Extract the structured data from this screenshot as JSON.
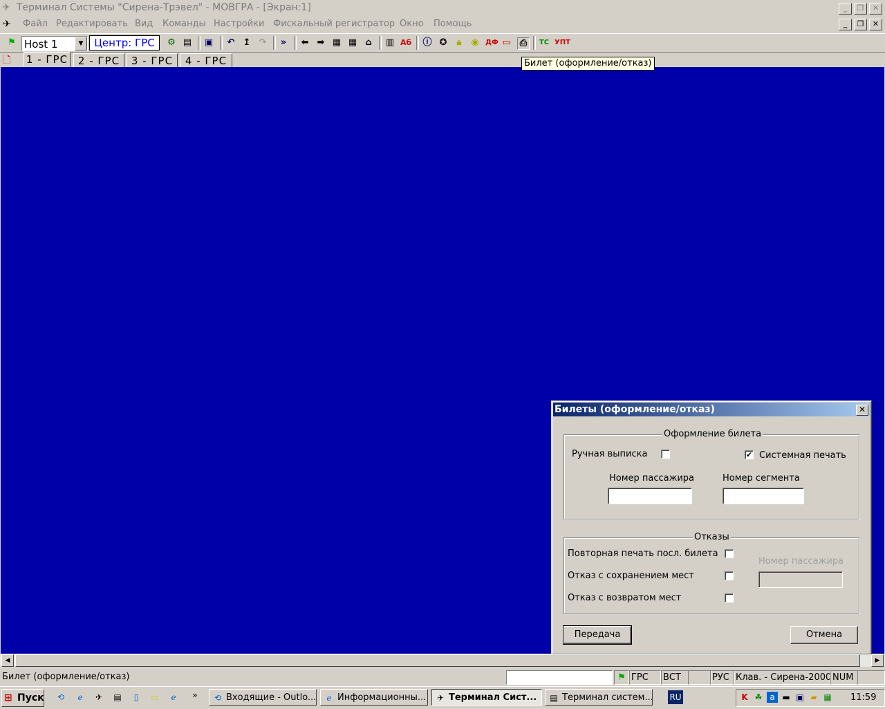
{
  "window": {
    "title": "Терминал Системы \"Сирена-Трэвел\" - МОВГРА - [Экран:1]"
  },
  "menu": [
    "Файл",
    "Редактировать",
    "Вид",
    "Команды",
    "Настройки",
    "Фискальный регистратор",
    "Окно",
    "Помощь"
  ],
  "toolbar": {
    "host_value": "Host 1",
    "center_label": "Центр: ГРС"
  },
  "tabs": [
    "1 - ГРС",
    "2 - ГРС",
    "3 - ГРС",
    "4 - ГРС"
  ],
  "tooltip": "Билет (оформление/отказ)",
  "workarea_color": "#0000a8",
  "dialog": {
    "title": "Билеты (оформление/отказ)",
    "issue_group": {
      "title": "Оформление билета",
      "manual_label": "Ручная выписка",
      "manual_checked": false,
      "system_print_label": "Системная печать",
      "system_print_checked": true,
      "passenger_no_label": "Номер пассажира",
      "passenger_no_value": "",
      "segment_no_label": "Номер сегмента",
      "segment_no_value": ""
    },
    "refusal_group": {
      "title": "Отказы",
      "reprint_label": "Повторная печать посл. билета",
      "keep_seats_label": "Отказ с сохранением мест",
      "return_seats_label": "Отказ с возвратом мест",
      "passenger_no_label": "Номер пассажира"
    },
    "send_button": "Передача",
    "cancel_button": "Отмена"
  },
  "statusbar": {
    "message": "Билет (оформление/отказ)",
    "grs": "ГРС",
    "vst": "ВСТ",
    "lang": "РУС",
    "keyboard": "Клав. - Сирена-2000",
    "num": "NUM"
  },
  "taskbar": {
    "start": "Пуск",
    "tasks": [
      "Входящие - Outlo...",
      "Информационны...",
      "Терминал Сист...",
      "Терминал систем..."
    ],
    "lang": "RU",
    "time": "11:59"
  }
}
